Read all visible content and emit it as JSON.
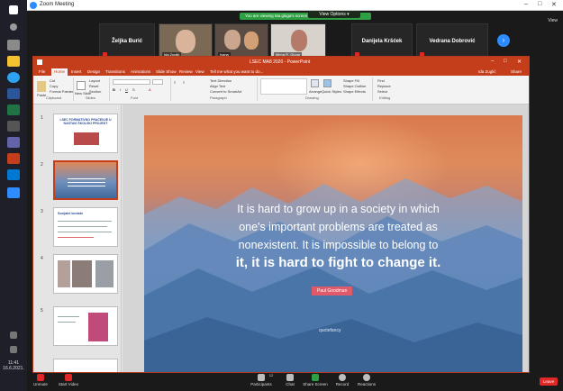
{
  "zoom": {
    "window_title": "Zoom Meeting",
    "share_banner": "You are viewing Ma.gluga's screen",
    "view_options": "View Options ▾",
    "view_button": "View",
    "participants": [
      {
        "name": "Željka Burić",
        "label": ""
      },
      {
        "name": "",
        "label": "Ida Zuglić"
      },
      {
        "name": "",
        "label": "Ivana"
      },
      {
        "name": "",
        "label": "Mirna R. Gluga"
      },
      {
        "name": "Danijela Kršćek",
        "label": ""
      },
      {
        "name": "Vedrana Dobrović",
        "label": ""
      }
    ],
    "toolbar": {
      "unmute": "Unmute",
      "start_video": "Start Video",
      "participants": "Participants",
      "participants_count": "12",
      "chat": "Chat",
      "share_screen": "Share Screen",
      "record": "Record",
      "reactions": "Reactions",
      "leave": "Leave"
    }
  },
  "taskbar": {
    "time": "11:41",
    "date": "16.6.2021."
  },
  "powerpoint": {
    "title": "LSEC MA8 2020 - PowerPoint",
    "tabs": [
      "File",
      "Home",
      "Insert",
      "Design",
      "Transitions",
      "Animations",
      "Slide Show",
      "Review",
      "View",
      "Tell me what you want to do..."
    ],
    "active_tab": "Home",
    "user": "Ida Zuglić",
    "share": "Share",
    "ribbon_groups": [
      "Clipboard",
      "Slides",
      "Font",
      "Paragraph",
      "Drawing",
      "Editing"
    ],
    "ribbon_buttons": {
      "paste": "Paste",
      "cut": "Cut",
      "copy": "Copy",
      "format_painter": "Format Painter",
      "new_slide": "New Slide",
      "layout": "Layout",
      "reset": "Reset",
      "section": "Section",
      "text_direction": "Text Direction",
      "align_text": "Align Text",
      "convert_smartart": "Convert to SmartArt",
      "arrange": "Arrange",
      "quick_styles": "Quick Styles",
      "shape_fill": "Shape Fill",
      "shape_outline": "Shape Outline",
      "shape_effects": "Shape Effects",
      "find": "Find",
      "replace": "Replace",
      "select": "Select"
    },
    "thumbnails": [
      {
        "num": "1",
        "title": "LSEC FORMATIVNO PRAĆENJE U NASTAVI ŠKOLSKI PROJEKT"
      },
      {
        "num": "2",
        "title": ""
      },
      {
        "num": "3",
        "title": "Socijalni kontakt"
      },
      {
        "num": "4",
        "title": ""
      },
      {
        "num": "5",
        "title": ""
      }
    ],
    "slide": {
      "quote_line1": "It is hard to grow up in a society in which",
      "quote_line2": "one's important problems are treated as",
      "quote_line3": "nonexistent. It is impossible to belong to",
      "quote_line4": "it, it is hard to fight to change it.",
      "author": "Paul Goodman",
      "credit": "quotefancy"
    }
  }
}
